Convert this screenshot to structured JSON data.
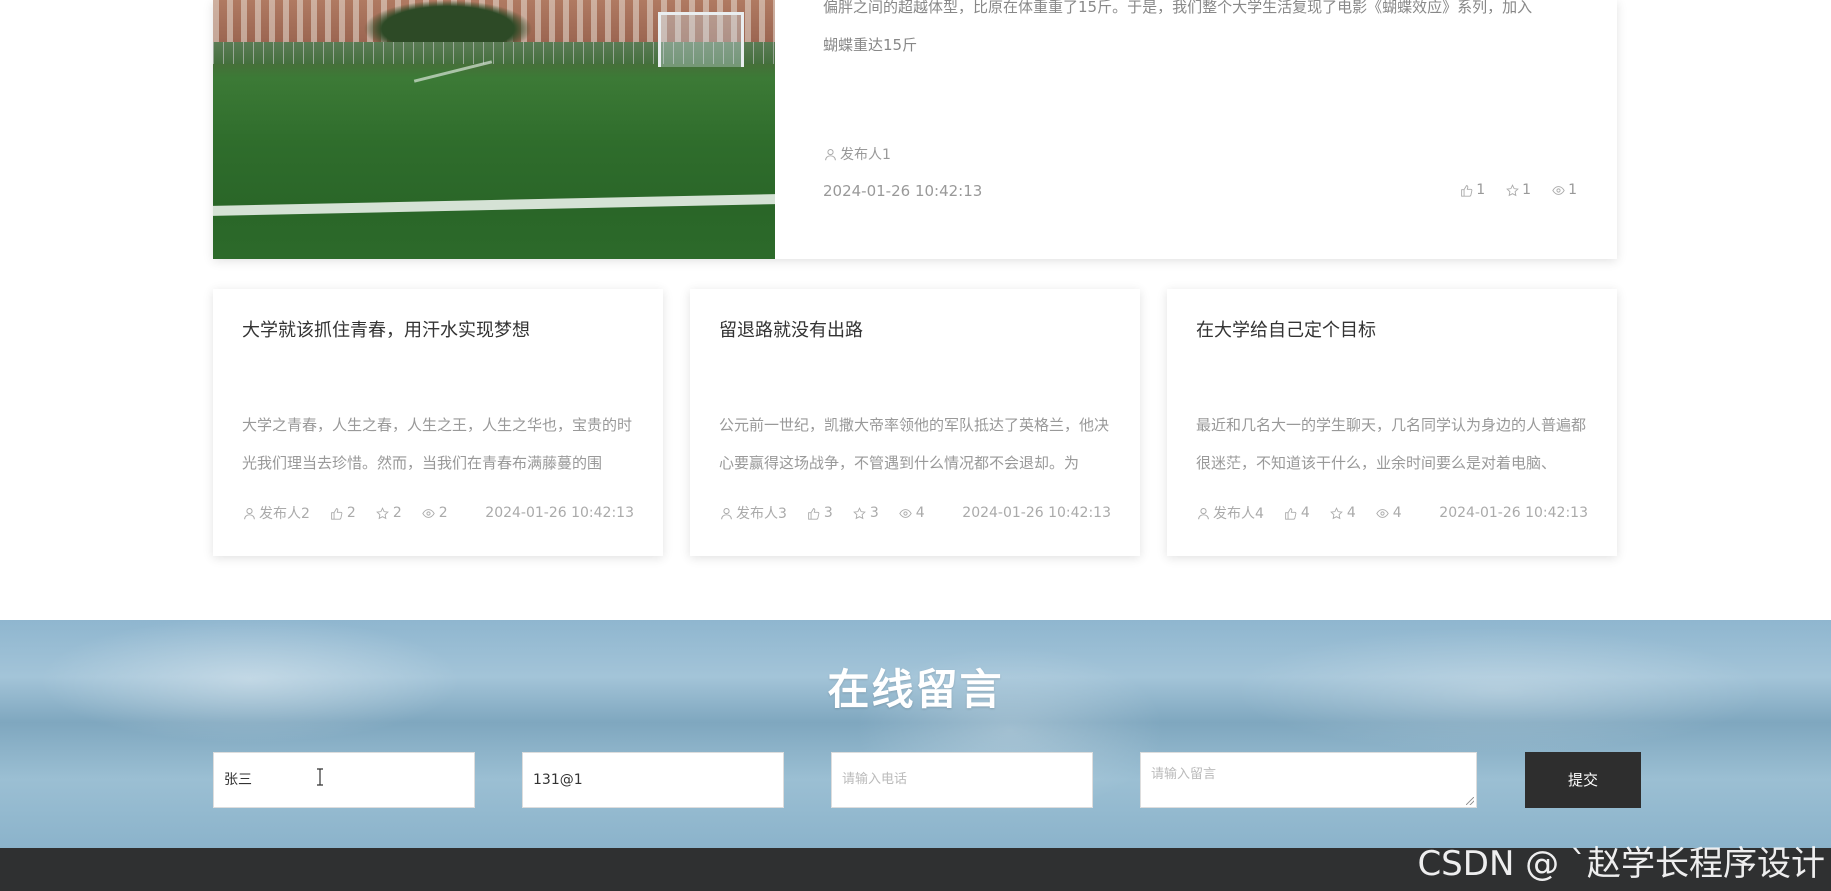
{
  "featured": {
    "excerpt_lines": [
      "偏胖之间的超越体型，比原在体重重了15斤。于是，我们整个大学生活复现了电影《蝴蝶效应》系列，加入",
      "蝴蝶重达15斤"
    ],
    "author": "发布人1",
    "date": "2024-01-26 10:42:13",
    "likes": "1",
    "favorites": "1",
    "views": "1"
  },
  "cards": [
    {
      "title": "大学就该抓住青春，用汗水实现梦想",
      "excerpt": "大学之青春，人生之春，人生之王，人生之华也，宝贵的时光我们理当去珍惜。然而，当我们在青春布满藤蔓的围",
      "author": "发布人2",
      "likes": "2",
      "favorites": "2",
      "views": "2",
      "date": "2024-01-26 10:42:13"
    },
    {
      "title": "留退路就没有出路",
      "excerpt": "公元前一世纪，凯撒大帝率领他的军队抵达了英格兰，他决心要赢得这场战争，不管遇到什么情况都不会退却。为",
      "author": "发布人3",
      "likes": "3",
      "favorites": "3",
      "views": "4",
      "date": "2024-01-26 10:42:13"
    },
    {
      "title": "在大学给自己定个目标",
      "excerpt": "最近和几名大一的学生聊天，几名同学认为身边的人普遍都很迷茫，不知道该干什么，业余时间要么是对着电脑、",
      "author": "发布人4",
      "likes": "4",
      "favorites": "4",
      "views": "4",
      "date": "2024-01-26 10:42:13"
    }
  ],
  "message": {
    "title": "在线留言",
    "name_value": "张三",
    "email_value": "131@1",
    "phone_placeholder": "请输入电话",
    "content_placeholder": "请输入留言",
    "submit_label": "提交"
  },
  "watermark": "CSDN @ `赵学长程序设计",
  "icons": {
    "author": "user-icon",
    "likes": "thumbs-up-icon",
    "favorites": "star-icon",
    "views": "eye-icon"
  }
}
